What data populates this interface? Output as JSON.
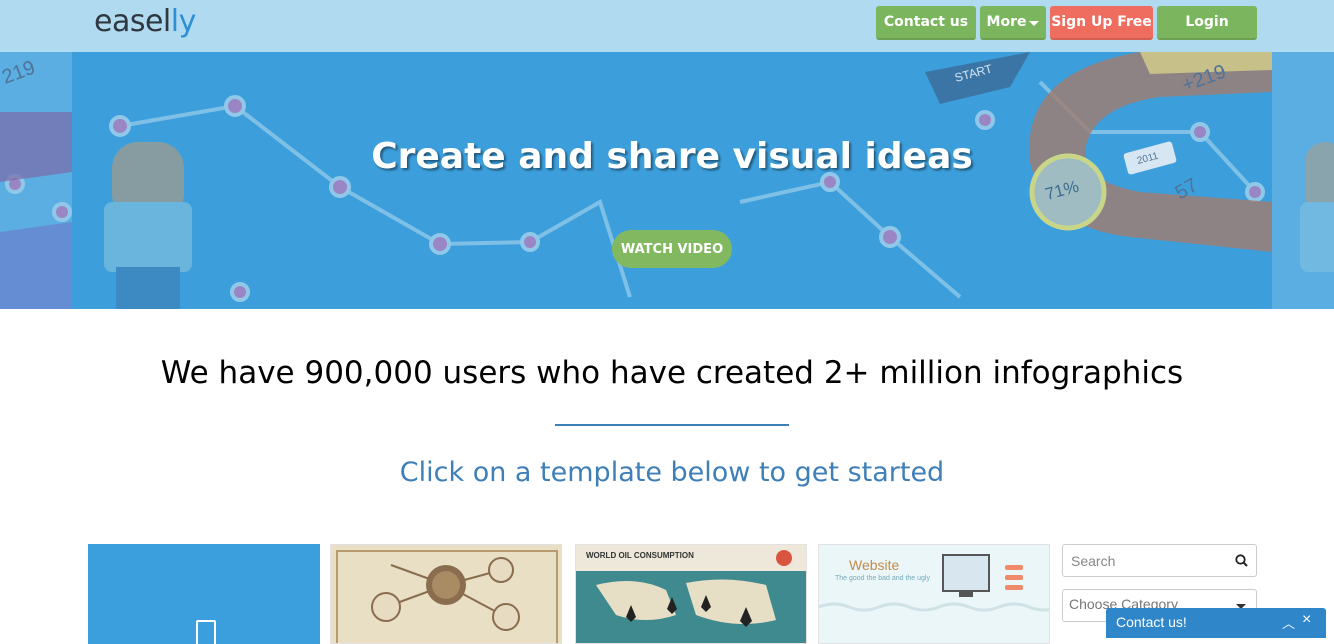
{
  "brand": {
    "logo_main": "easel",
    "logo_accent": "ly"
  },
  "nav": {
    "contact": "Contact us",
    "more": "More",
    "signup": "Sign Up Free",
    "login": "Login"
  },
  "hero": {
    "title": "Create and share visual ideas",
    "watch_label": "WATCH VIDEO",
    "deco_start": "START",
    "deco_plus219": "+219",
    "deco_2011": "2011",
    "deco_71": "71%",
    "deco_57": "57",
    "deco_left_219": "219"
  },
  "main": {
    "headline": "We have 900,000 users who have created 2+ million infographics",
    "subline": "Click on a template below to get started"
  },
  "templates": {
    "t2_title": "WORLD OIL CONSUMPTION",
    "t3_title": "Website",
    "t3_sub": "The good the bad and the ugly"
  },
  "sidebar": {
    "search_placeholder": "Search",
    "category_placeholder": "Choose Category"
  },
  "chat": {
    "label": "Contact us!"
  },
  "colors": {
    "topbar": "#b0daf0",
    "hero": "#3c9fdc",
    "green": "#7bb65e",
    "red": "#ef6d5e",
    "accent_text": "#3f7fb8"
  }
}
